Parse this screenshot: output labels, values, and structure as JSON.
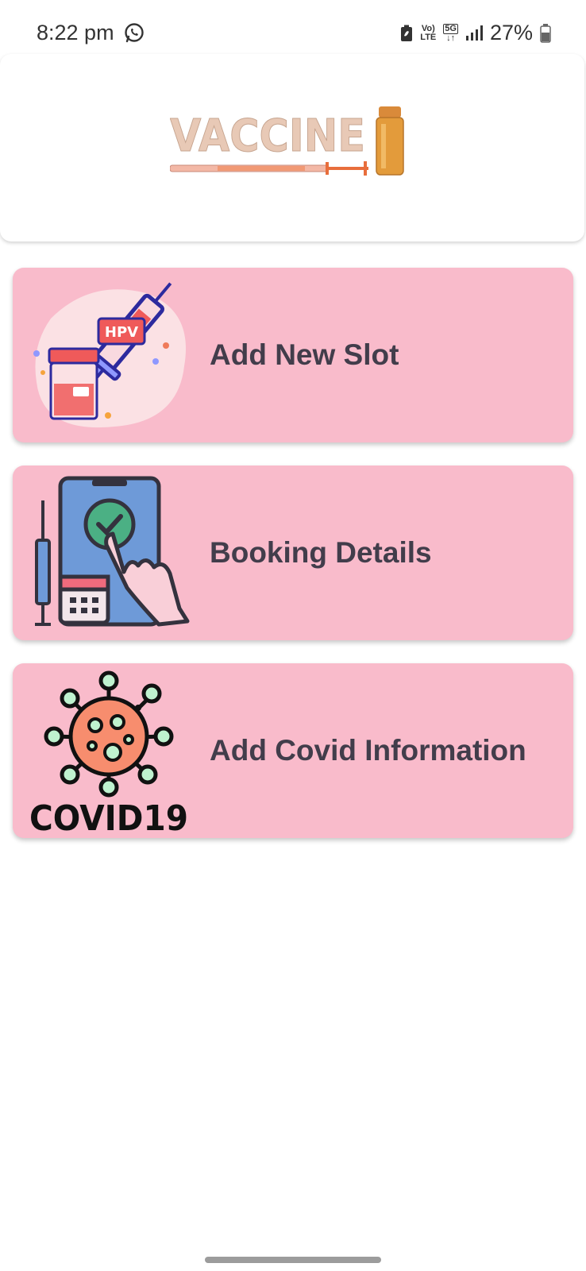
{
  "status_bar": {
    "time": "8:22 pm",
    "net_top": "Vo)",
    "net_bottom": "LTE",
    "gen": "5G",
    "battery": "27%"
  },
  "header": {
    "logo_text": "VACCINE",
    "logo_icon": "syringe-vial-logo"
  },
  "menu": {
    "items": [
      {
        "label": "Add New Slot",
        "icon": "hpv-syringe-illustration",
        "badge": "HPV"
      },
      {
        "label": "Booking Details",
        "icon": "phone-booking-illustration"
      },
      {
        "label": "Add Covid Information",
        "icon": "covid19-virus-illustration",
        "caption": "COVID19"
      }
    ]
  },
  "colors": {
    "card_bg": "#f9bbcb",
    "label": "#423d4b",
    "logo_letters": "#e8c9b6"
  }
}
